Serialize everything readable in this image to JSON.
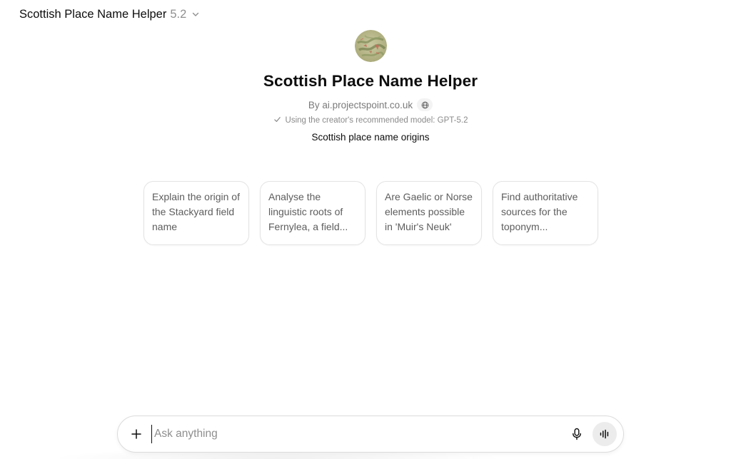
{
  "header": {
    "app_name": "Scottish Place Name Helper",
    "version": "5.2",
    "chevron_icon": "chevron-down-icon"
  },
  "hero": {
    "avatar_icon": "map-avatar",
    "title": "Scottish Place Name Helper",
    "byline": "By ai.projectspoint.co.uk",
    "globe_icon": "globe-icon",
    "model_check_icon": "check-icon",
    "model_note": "Using the creator's recommended model: GPT-5.2",
    "description": "Scottish place name origins"
  },
  "suggestions": [
    {
      "text": "Explain the origin of the Stackyard field name"
    },
    {
      "text": "Analyse the linguistic roots of Fernylea, a field..."
    },
    {
      "text": "Are Gaelic or Norse elements possible in 'Muir's Neuk'"
    },
    {
      "text": "Find authoritative sources for the toponym..."
    }
  ],
  "composer": {
    "plus_icon": "plus-icon",
    "placeholder": "Ask anything",
    "mic_icon": "microphone-icon",
    "voice_icon": "voice-mode-icon"
  },
  "colors": {
    "text_primary": "#0d0d0d",
    "text_secondary": "#7a7a7a",
    "card_border": "#e3e3e3",
    "voice_button_bg": "#ececec"
  }
}
